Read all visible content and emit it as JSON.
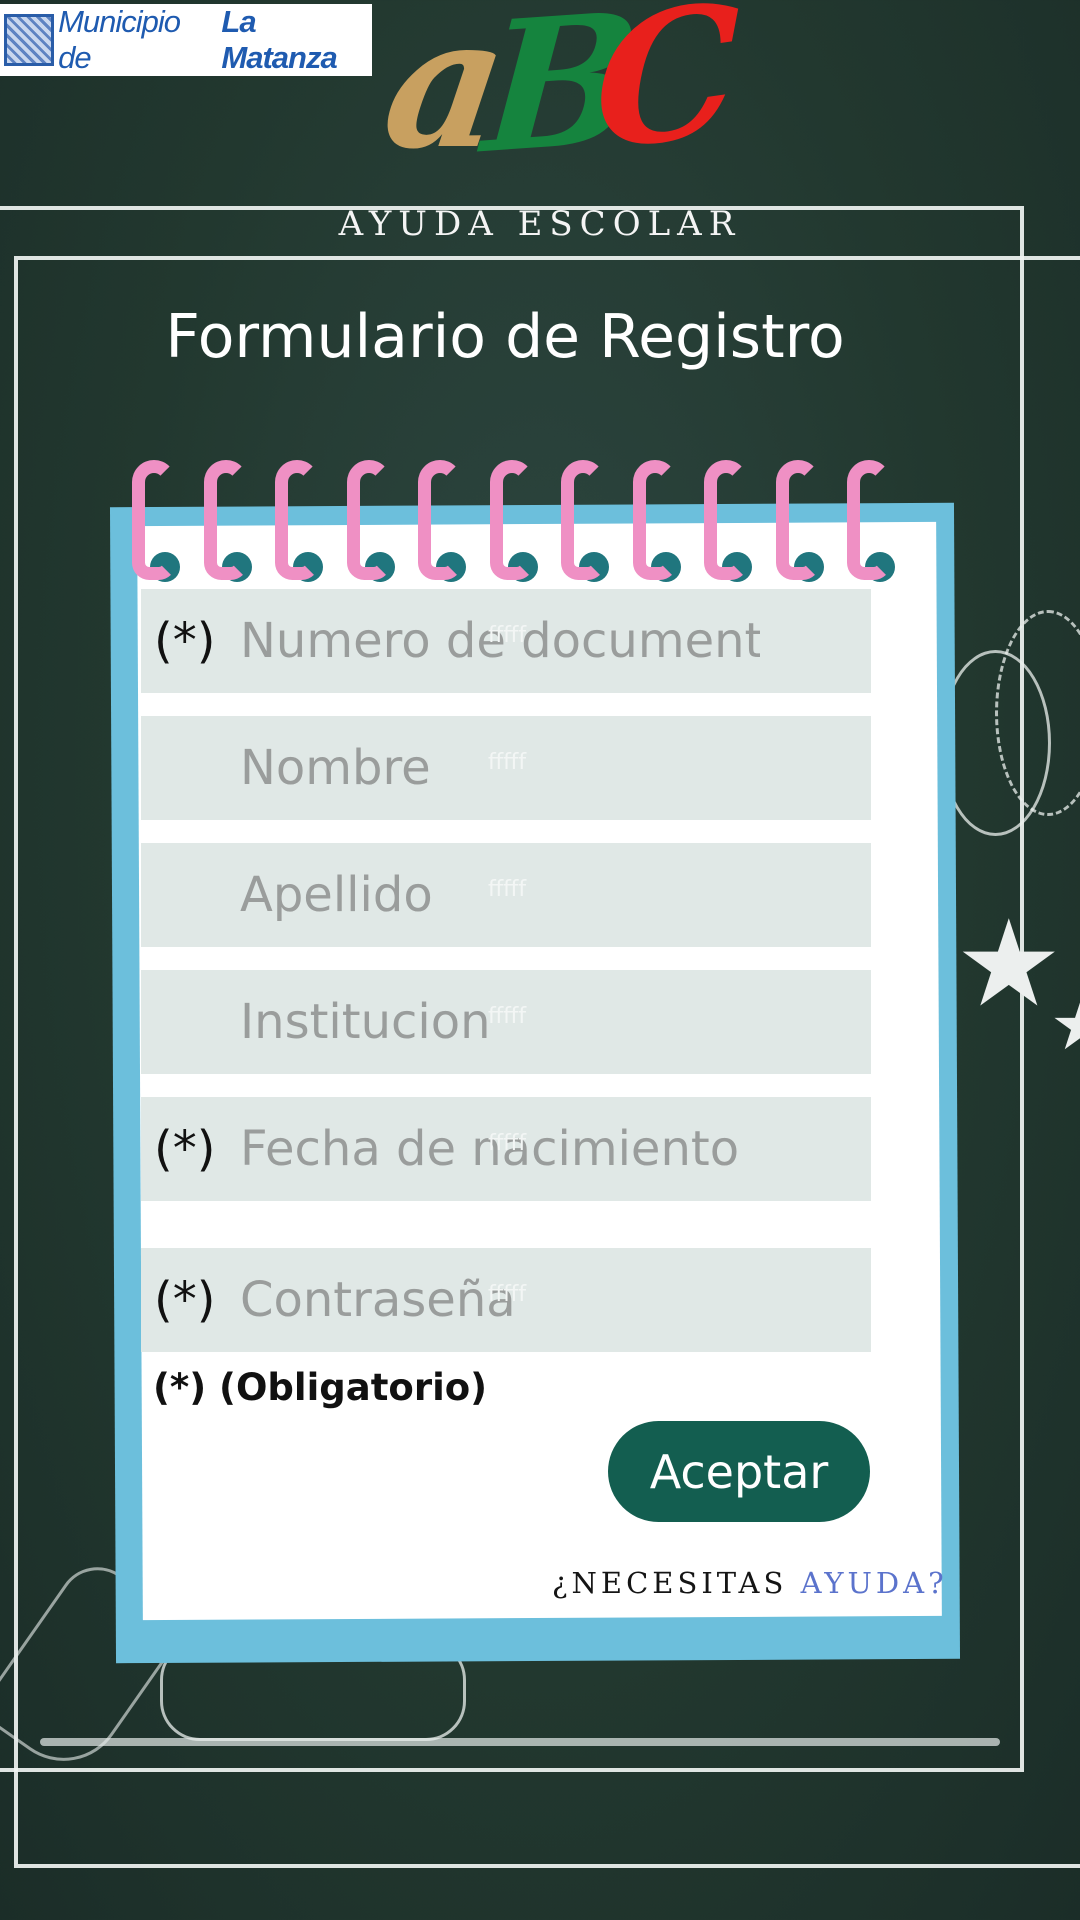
{
  "header": {
    "logo_text_light": "Municipio de",
    "logo_text_bold": "La Matanza",
    "brand_letters": [
      "a",
      "B",
      "C"
    ],
    "subtitle": "AYUDA ESCOLAR"
  },
  "form": {
    "title": "Formulario de Registro",
    "ghost_text": "fffff",
    "required_marker": "(*)",
    "fields": [
      {
        "placeholder": "Numero de documento",
        "required": true
      },
      {
        "placeholder": "Nombre",
        "required": false
      },
      {
        "placeholder": "Apellido",
        "required": false
      },
      {
        "placeholder": "Institucion",
        "required": false
      },
      {
        "placeholder": "Fecha de nacimiento",
        "required": true
      },
      {
        "placeholder": "Contraseña",
        "required": true
      }
    ],
    "mandatory_note": "(*) (Obligatorio)",
    "submit_label": "Aceptar",
    "help_prefix": "¿NECESITAS",
    "help_link": "AYUDA?"
  },
  "colors": {
    "background": "#22382f",
    "card_border": "#6cbfdc",
    "ring": "#ef90c4",
    "field_bg": "#e0e8e6",
    "button": "#135e50",
    "help_link": "#5b73cc",
    "brand_a": "#c8a060",
    "brand_b": "#15843e",
    "brand_c": "#e8201c"
  }
}
